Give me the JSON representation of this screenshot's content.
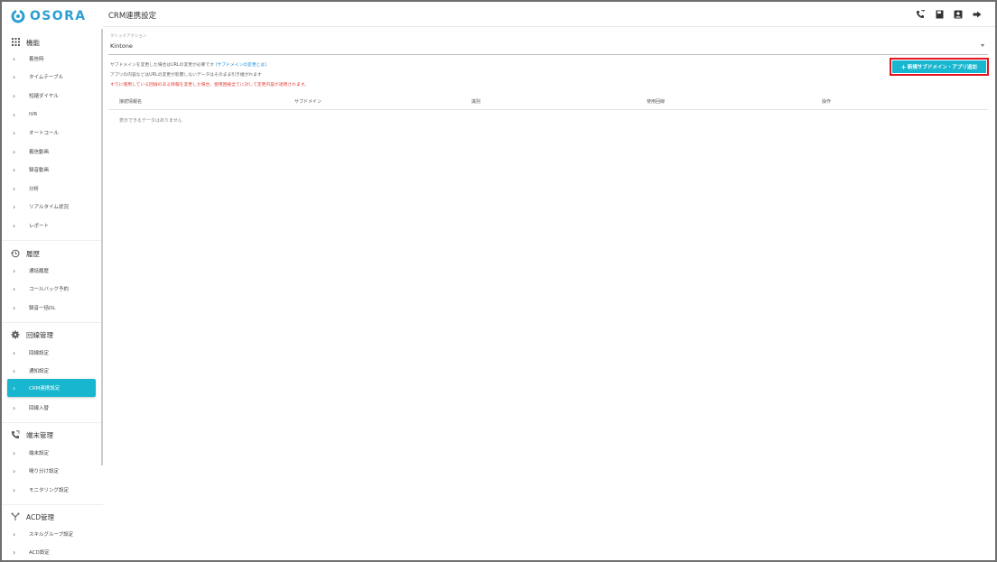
{
  "brand": {
    "name": "OSORA",
    "color": "#2d9fd2"
  },
  "accent": "#19b6cf",
  "sidebar": {
    "sections": [
      {
        "title": "機能",
        "icon": "grid-icon",
        "items": [
          "着信時",
          "タイムテーブル",
          "短縮ダイヤル",
          "IVR",
          "オートコール",
          "着信動画",
          "録音動画",
          "分析",
          "リアルタイム状況",
          "レポート"
        ]
      },
      {
        "title": "履歴",
        "icon": "history-icon",
        "items": [
          "通話履歴",
          "コールバック予約",
          "録音一括DL"
        ]
      },
      {
        "title": "回線管理",
        "icon": "gear-icon",
        "items": [
          "回線設定",
          "通知設定",
          "CRM連携設定",
          "回線入替"
        ]
      },
      {
        "title": "端末管理",
        "icon": "phone-icon",
        "items": [
          "端末設定",
          "鳴り分け設定",
          "モニタリング設定"
        ]
      },
      {
        "title": "ACD管理",
        "icon": "branch-icon",
        "items": [
          "スキルグループ設定",
          "ACD設定"
        ]
      }
    ],
    "active_item": "CRM連携設定"
  },
  "header": {
    "title": "CRM連携設定",
    "icons": [
      "phone-transfer-icon",
      "save-icon",
      "contact-icon",
      "logout-icon"
    ]
  },
  "main": {
    "select": {
      "label": "クリックアクション",
      "value": "Kintone"
    },
    "info": {
      "line1": "サブドメインを変更した場合はURLの変更が必要です",
      "line1_link": "(サブドメインの変更とは)",
      "line2": "アプリの内容などはURLの変更が影響しないデータはそのまま引き継がれます",
      "warning": "すでに使用している回線のある情報を変更した場合、使用回線全てに対して変更内容が適用されます。"
    },
    "add_button": {
      "label": "新規サブドメイン・アプリ追加",
      "highlight": "#e3151e"
    },
    "table": {
      "columns": [
        "接続情報名",
        "サブドメイン",
        "識別",
        "使用回線",
        "操作"
      ],
      "empty_text": "表示できるデータはありません"
    }
  }
}
